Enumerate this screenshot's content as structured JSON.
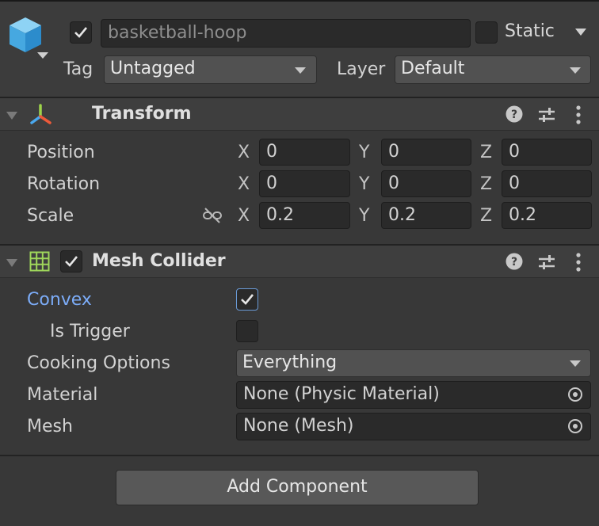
{
  "object": {
    "name": "basketball-hoop",
    "active": true,
    "static_label": "Static",
    "static_checked": false,
    "tag_label": "Tag",
    "tag_value": "Untagged",
    "layer_label": "Layer",
    "layer_value": "Default"
  },
  "transform": {
    "title": "Transform",
    "position": {
      "label": "Position",
      "x": "0",
      "y": "0",
      "z": "0"
    },
    "rotation": {
      "label": "Rotation",
      "x": "0",
      "y": "0",
      "z": "0"
    },
    "scale": {
      "label": "Scale",
      "x": "0.2",
      "y": "0.2",
      "z": "0.2"
    },
    "axes": {
      "x": "X",
      "y": "Y",
      "z": "Z"
    }
  },
  "mesh_collider": {
    "title": "Mesh Collider",
    "enabled": true,
    "convex": {
      "label": "Convex",
      "checked": true
    },
    "is_trigger": {
      "label": "Is Trigger",
      "checked": false
    },
    "cooking_options": {
      "label": "Cooking Options",
      "value": "Everything"
    },
    "material": {
      "label": "Material",
      "value": "None (Physic Material)"
    },
    "mesh": {
      "label": "Mesh",
      "value": "None (Mesh)"
    }
  },
  "add_component_label": "Add Component",
  "colors": {
    "background": "#383838",
    "header": "#3c3c3c",
    "field": "#2a2a2a",
    "accent_label": "#7cacf8",
    "grid_icon": "#9fd65b"
  }
}
